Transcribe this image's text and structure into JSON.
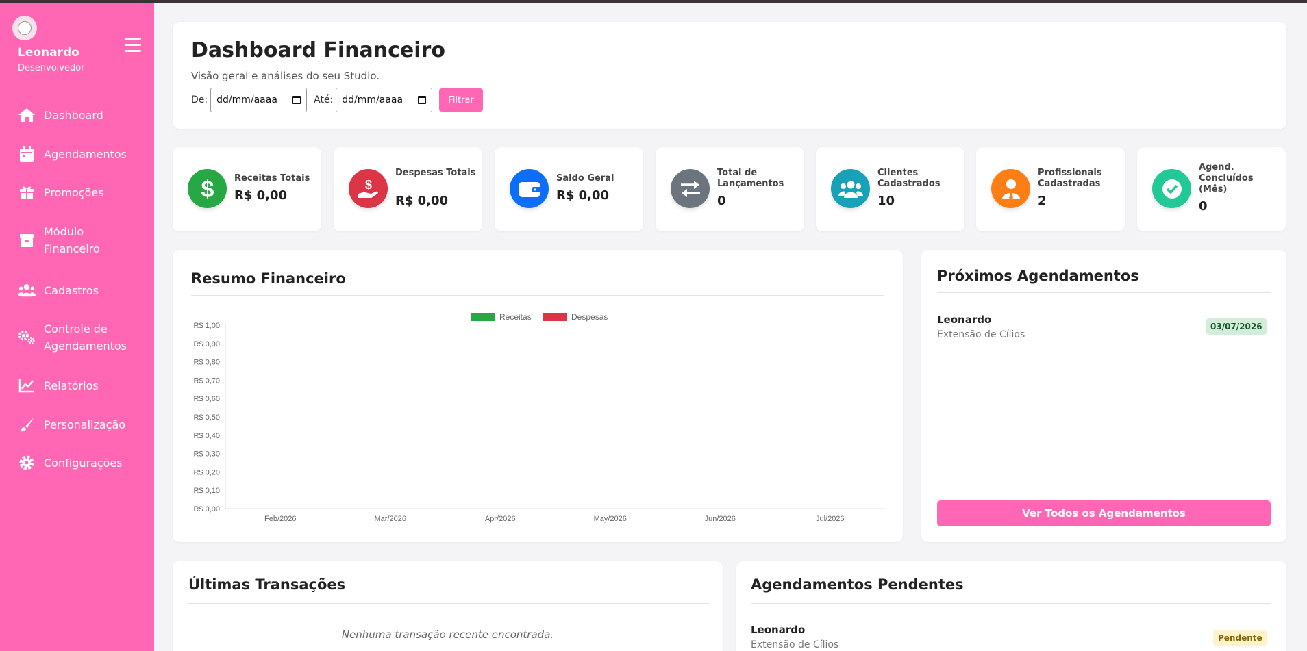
{
  "sidebar": {
    "user_name": "Leonardo",
    "user_role": "Desenvolvedor",
    "items": [
      {
        "label": "Dashboard",
        "icon": "home-icon"
      },
      {
        "label": "Agendamentos",
        "icon": "calendar-icon"
      },
      {
        "label": "Promoções",
        "icon": "gift-icon"
      },
      {
        "label": "Módulo Financeiro",
        "icon": "archive-icon"
      },
      {
        "label": "Cadastros",
        "icon": "users-icon"
      },
      {
        "label": "Controle de Agendamentos",
        "icon": "cogs-icon"
      },
      {
        "label": "Relatórios",
        "icon": "chart-line-icon"
      },
      {
        "label": "Personalização",
        "icon": "brush-icon"
      },
      {
        "label": "Configurações",
        "icon": "gear-icon"
      }
    ]
  },
  "header": {
    "title": "Dashboard Financeiro",
    "subtitle": "Visão geral e análises do seu Studio.",
    "from_label": "De:",
    "to_label": "Até:",
    "from_placeholder": "dd/mm/aaaa",
    "to_placeholder": "dd/mm/aaaa",
    "filter_label": "Filtrar"
  },
  "stats": [
    {
      "label": "Receitas Totais",
      "value": "R$ 0,00",
      "color": "#28a745",
      "icon": "dollar-icon"
    },
    {
      "label": "Despesas Totais",
      "value": "R$ 0,00",
      "color": "#dc3545",
      "icon": "hand-dollar-icon"
    },
    {
      "label": "Saldo Geral",
      "value": "R$ 0,00",
      "color": "#0d6efd",
      "icon": "wallet-icon"
    },
    {
      "label": "Total de Lançamentos",
      "value": "0",
      "color": "#6c757d",
      "icon": "exchange-icon"
    },
    {
      "label": "Clientes Cadastrados",
      "value": "10",
      "color": "#17a2b8",
      "icon": "users-icon"
    },
    {
      "label": "Profissionais Cadastradas",
      "value": "2",
      "color": "#fd7e14",
      "icon": "user-tie-icon"
    },
    {
      "label": "Agend. Concluídos (Mês)",
      "value": "0",
      "color": "#20c997",
      "icon": "check-circle-icon"
    }
  ],
  "summary": {
    "title": "Resumo Financeiro"
  },
  "chart_data": {
    "type": "bar",
    "categories": [
      "Feb/2026",
      "Mar/2026",
      "Apr/2026",
      "May/2026",
      "Jun/2026",
      "Jul/2026"
    ],
    "series": [
      {
        "name": "Receitas",
        "color": "#28a745",
        "values": [
          0,
          0,
          0,
          0,
          0,
          0
        ]
      },
      {
        "name": "Despesas",
        "color": "#dc3545",
        "values": [
          0,
          0,
          0,
          0,
          0,
          0
        ]
      }
    ],
    "yticks": [
      "R$ 0,00",
      "R$ 0,10",
      "R$ 0,20",
      "R$ 0,30",
      "R$ 0,40",
      "R$ 0,50",
      "R$ 0,60",
      "R$ 0,70",
      "R$ 0,80",
      "R$ 0,90",
      "R$ 1,00"
    ],
    "ylim": [
      0,
      1
    ],
    "legend_position": "top",
    "grid": false
  },
  "upcoming": {
    "title": "Próximos Agendamentos",
    "items": [
      {
        "name": "Leonardo",
        "service": "Extensão de Cílios",
        "date": "03/07/2026"
      }
    ],
    "button_label": "Ver Todos os Agendamentos"
  },
  "transactions": {
    "title": "Últimas Transações",
    "empty": "Nenhuma transação recente encontrada."
  },
  "pending": {
    "title": "Agendamentos Pendentes",
    "items": [
      {
        "name": "Leonardo",
        "service": "Extensão de Cílios",
        "status": "Pendente"
      }
    ]
  }
}
